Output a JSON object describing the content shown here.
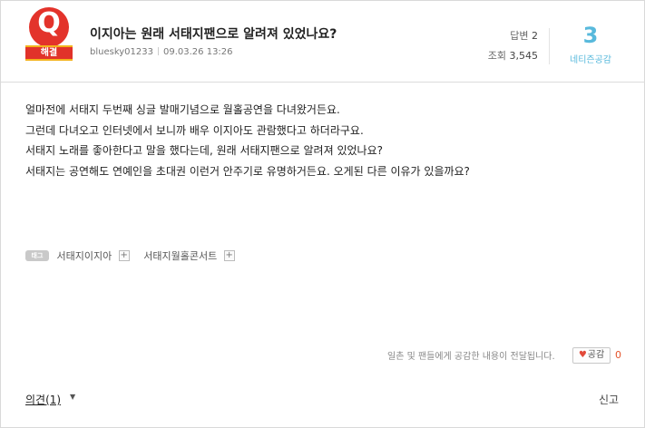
{
  "badge": {
    "letter": "Q",
    "status": "해결"
  },
  "question": {
    "title": "이지아는 원래 서태지팬으로 알려져 있었나요?",
    "author": "bluesky01233",
    "datetime": "09.03.26 13:26"
  },
  "stats": {
    "answers_label": "답변",
    "answers_value": "2",
    "views_label": "조회",
    "views_value": "3,545",
    "empathy_count": "3",
    "empathy_label": "네티즌공감"
  },
  "body": {
    "lines": [
      "얼마전에 서태지 두번째 싱글 발매기념으로 월홀공연을 다녀왔거든요.",
      "그런데 다녀오고 인터넷에서 보니까 배우 이지아도 관람했다고 하더라구요.",
      "서태지 노래를 좋아한다고 말을 했다는데, 원래 서태지팬으로 알려져 있었나요?",
      "서태지는 공연해도 연예인을 초대권 이런거 안주기로 유명하거든요. 오게된 다른 이유가 있을까요?"
    ]
  },
  "tags": {
    "icon_label": "태그",
    "items": [
      "서태지이지아",
      "서태지월홀콘서트"
    ]
  },
  "footer": {
    "notice": "일촌 및 팬들에게 공감한 내용이 전달됩니다.",
    "empathy_button": "공감",
    "empathy_button_count": "0",
    "opinion_link": "의견(1)",
    "report_link": "신고"
  },
  "colors": {
    "badge_red": "#e3332b",
    "ribbon_gold": "#f3b31c",
    "empathy_blue": "#58b9dc",
    "count_orange": "#e4542b"
  }
}
